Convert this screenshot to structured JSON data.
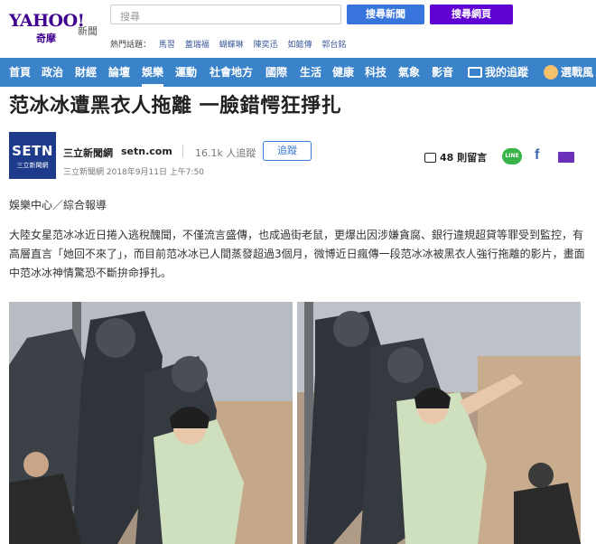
{
  "header": {
    "brand": "YAHOO!",
    "brand_cn": "奇摩",
    "section": "新聞",
    "search_placeholder": "搜尋",
    "btn_news": "搜尋新聞",
    "btn_web": "搜尋網頁",
    "hot_title": "熱門話題：",
    "hot_topics": [
      "馬習",
      "蓋瑞福",
      "蝴蝶琳",
      "陳奕迅",
      "如懿傳",
      "郭台銘"
    ]
  },
  "nav": {
    "items": [
      "首頁",
      "政治",
      "財經",
      "論壇",
      "娛樂",
      "運動",
      "社會地方",
      "國際",
      "生活",
      "健康",
      "科技",
      "氣象",
      "影音"
    ],
    "active": "娛樂",
    "my_follow": "我的追蹤",
    "user": "選戰風"
  },
  "article": {
    "title": "范冰冰遭黑衣人拖離 一臉錯愕狂掙扎",
    "source_logo_main": "SETN",
    "source_logo_sub": "三立新聞網",
    "source_name": "三立新聞網",
    "source_url": "setn.com",
    "followers": "16.1k 人追蹤",
    "follow_btn": "追蹤",
    "byline": "三立新聞網 2018年9月11日 上午7:50",
    "comments": "48 則留言",
    "share_line": "LINE",
    "share_fb": "f",
    "dept": "娛樂中心／綜合報導",
    "body": "大陸女星范冰冰近日捲入逃稅醜聞，不僅流言盛傳，也成過街老鼠，更爆出因涉嫌貪腐、銀行違規超貸等罪受到監控，有高層直言「她回不來了」，而目前范冰冰已人間蒸發超過3個月，微博近日瘋傳一段范冰冰被黑衣人強行拖離的影片，畫面中范冰冰神情驚恐不斷拚命掙扎。"
  }
}
